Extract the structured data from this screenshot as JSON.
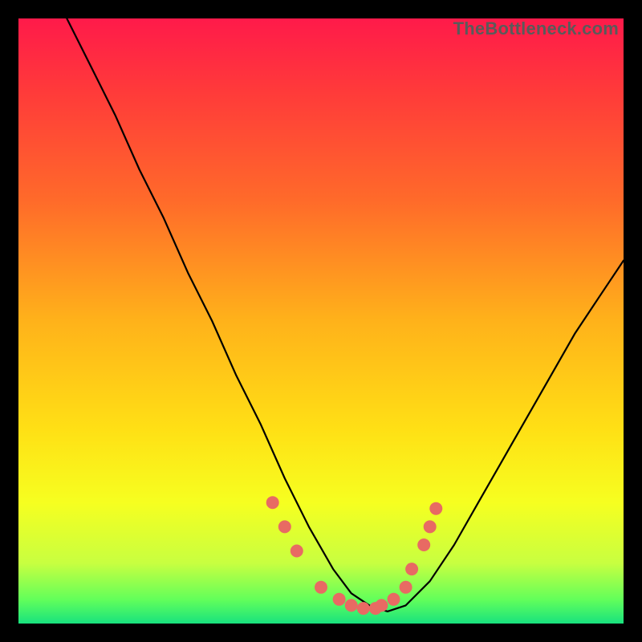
{
  "watermark": "TheBottleneck.com",
  "colors": {
    "background": "#000000",
    "gradient_top": "#ff1a4a",
    "gradient_bottom": "#18e27e",
    "curve": "#000000",
    "markers": "#e86a63"
  },
  "chart_data": {
    "type": "line",
    "title": "",
    "xlabel": "",
    "ylabel": "",
    "xlim": [
      0,
      100
    ],
    "ylim": [
      0,
      100
    ],
    "grid": false,
    "legend": false,
    "note": "No axis ticks or numbers are rendered. x/y values are estimated from pixel positions on a 0–100 scale (top-left origin flipped to bottom-left for y).",
    "series": [
      {
        "name": "curve",
        "x": [
          8,
          12,
          16,
          20,
          24,
          28,
          32,
          36,
          40,
          44,
          48,
          52,
          55,
          58,
          61,
          64,
          68,
          72,
          76,
          80,
          84,
          88,
          92,
          96,
          100
        ],
        "y": [
          100,
          92,
          84,
          75,
          67,
          58,
          50,
          41,
          33,
          24,
          16,
          9,
          5,
          3,
          2,
          3,
          7,
          13,
          20,
          27,
          34,
          41,
          48,
          54,
          60
        ]
      }
    ],
    "markers": {
      "name": "highlight-points",
      "note": "Salmon marker dots clustered near the valley and on the ascending side.",
      "x": [
        42,
        44,
        46,
        50,
        53,
        55,
        57,
        59,
        60,
        62,
        64,
        65,
        67,
        68,
        69
      ],
      "y": [
        20,
        16,
        12,
        6,
        4,
        3,
        2.5,
        2.5,
        3,
        4,
        6,
        9,
        13,
        16,
        19
      ]
    }
  }
}
